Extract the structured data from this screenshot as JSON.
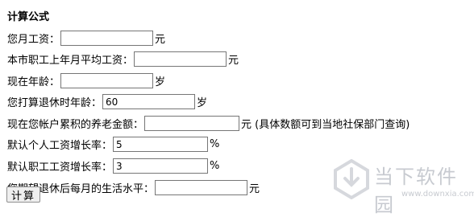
{
  "form": {
    "title": "计算公式",
    "fields": [
      {
        "label": "您月工资：",
        "value": "",
        "suffix": "元"
      },
      {
        "label": "本市职工上年月平均工资：",
        "value": "",
        "suffix": "元"
      },
      {
        "label": "现在年龄：",
        "value": "",
        "suffix": "岁"
      },
      {
        "label": "您打算退休时年龄：",
        "value": "60",
        "suffix": "岁"
      },
      {
        "label": "现在您帐户累积的养老金额：",
        "value": "",
        "suffix": "元 (具体数额可到当地社保部门查询)"
      },
      {
        "label": "默认个人工资增长率：",
        "value": "5",
        "suffix": "%"
      },
      {
        "label": "默认职工工资增长率：",
        "value": "3",
        "suffix": "%"
      },
      {
        "label": "您期望退休后每月的生活水平：",
        "value": "",
        "suffix": "元"
      }
    ],
    "calculate_label": "计算"
  },
  "watermark": {
    "text": "当下软件园",
    "url": "www.downxia.com"
  }
}
